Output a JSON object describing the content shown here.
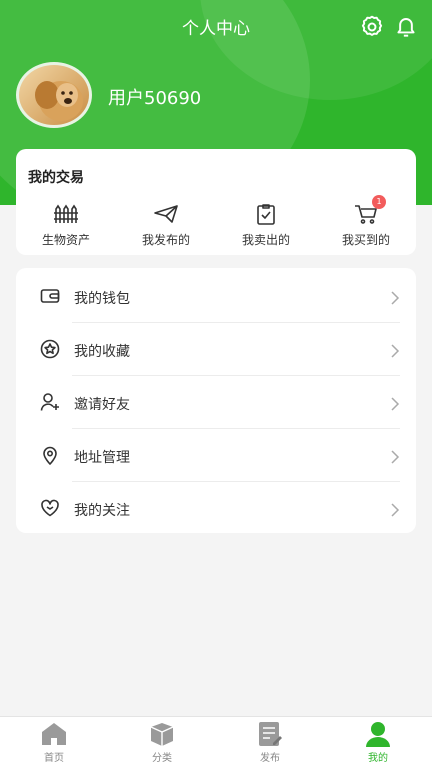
{
  "header": {
    "title": "个人中心",
    "settings_icon": "gear-icon",
    "notifications_icon": "bell-icon",
    "username": "用户50690",
    "accent_color": "#2fb52c"
  },
  "trade": {
    "title": "我的交易",
    "items": [
      {
        "label": "生物资产",
        "icon": "fence-icon"
      },
      {
        "label": "我发布的",
        "icon": "paper-plane-icon"
      },
      {
        "label": "我卖出的",
        "icon": "clipboard-check-icon"
      },
      {
        "label": "我买到的",
        "icon": "cart-icon",
        "badge": "1"
      }
    ]
  },
  "menu": {
    "items": [
      {
        "label": "我的钱包",
        "icon": "wallet-icon"
      },
      {
        "label": "我的收藏",
        "icon": "star-icon"
      },
      {
        "label": "邀请好友",
        "icon": "add-user-icon"
      },
      {
        "label": "地址管理",
        "icon": "location-pin-icon"
      },
      {
        "label": "我的关注",
        "icon": "heart-icon"
      }
    ]
  },
  "tabbar": {
    "items": [
      {
        "label": "首页",
        "icon": "home-icon"
      },
      {
        "label": "分类",
        "icon": "box-icon"
      },
      {
        "label": "发布",
        "icon": "publish-icon"
      },
      {
        "label": "我的",
        "icon": "user-icon"
      }
    ],
    "active_index": 3
  }
}
